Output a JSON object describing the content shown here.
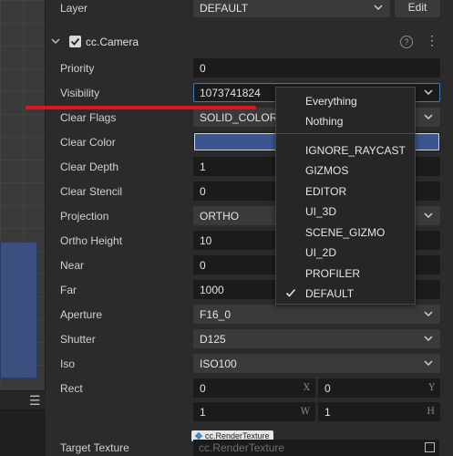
{
  "inspector": {
    "layer": {
      "label": "Layer",
      "value": "DEFAULT",
      "edit_label": "Edit"
    },
    "component": {
      "title": "cc.Camera",
      "help_glyph": "?",
      "more_glyph": "⋮"
    },
    "props": {
      "priority": {
        "label": "Priority",
        "value": "0"
      },
      "visibility": {
        "label": "Visibility",
        "value": "1073741824"
      },
      "clear_flags": {
        "label": "Clear Flags",
        "value": "SOLID_COLOR"
      },
      "clear_color": {
        "label": "Clear Color",
        "color": "#3b5592"
      },
      "clear_depth": {
        "label": "Clear Depth",
        "value": "1"
      },
      "clear_stencil": {
        "label": "Clear Stencil",
        "value": "0"
      },
      "projection": {
        "label": "Projection",
        "value": "ORTHO"
      },
      "ortho_height": {
        "label": "Ortho Height",
        "value": "10"
      },
      "near": {
        "label": "Near",
        "value": "0"
      },
      "far": {
        "label": "Far",
        "value": "1000"
      },
      "aperture": {
        "label": "Aperture",
        "value": "F16_0"
      },
      "shutter": {
        "label": "Shutter",
        "value": "D125"
      },
      "iso": {
        "label": "Iso",
        "value": "ISO100"
      },
      "rect": {
        "label": "Rect",
        "x": {
          "value": "0",
          "axis": "X"
        },
        "y": {
          "value": "0",
          "axis": "Y"
        },
        "w": {
          "value": "1",
          "axis": "W"
        },
        "h": {
          "value": "1",
          "axis": "H"
        }
      },
      "target_texture": {
        "label": "Target Texture",
        "tag": "cc.RenderTexture",
        "placeholder": "cc.RenderTexture"
      }
    }
  },
  "visibility_dropdown": {
    "items": [
      "Everything",
      "Nothing",
      "IGNORE_RAYCAST",
      "GIZMOS",
      "EDITOR",
      "UI_3D",
      "SCENE_GIZMO",
      "UI_2D",
      "PROFILER",
      "DEFAULT"
    ],
    "checked": "DEFAULT"
  },
  "scene": {
    "menu_icon": "hamburger-icon"
  },
  "colors": {
    "accent_focus": "#3d7ab8",
    "annotation_red": "#e2161a",
    "clear_color_swatch": "#3b5592"
  }
}
